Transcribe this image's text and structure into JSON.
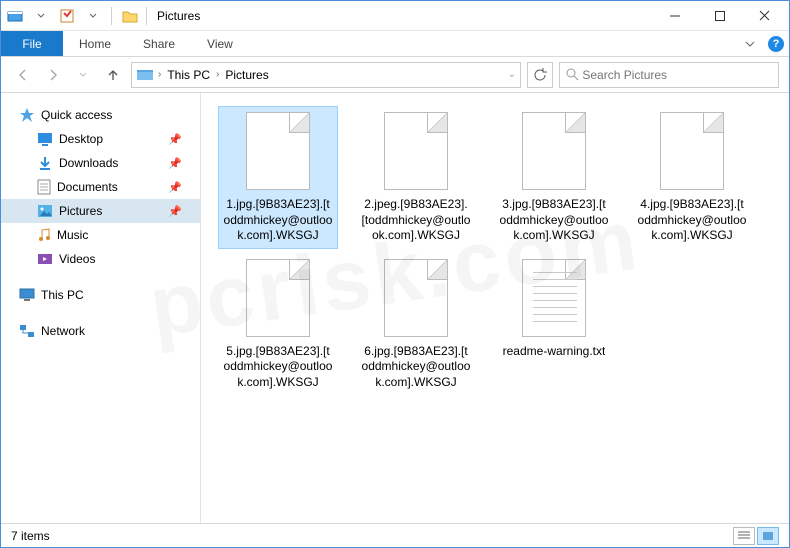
{
  "title": "Pictures",
  "ribbon": {
    "file": "File",
    "tabs": [
      "Home",
      "Share",
      "View"
    ]
  },
  "breadcrumb": {
    "root": "This PC",
    "current": "Pictures"
  },
  "search": {
    "placeholder": "Search Pictures"
  },
  "tree": {
    "quick": "Quick access",
    "items": [
      {
        "label": "Desktop",
        "pinned": true
      },
      {
        "label": "Downloads",
        "pinned": true
      },
      {
        "label": "Documents",
        "pinned": true
      },
      {
        "label": "Pictures",
        "pinned": true,
        "selected": true
      },
      {
        "label": "Music",
        "pinned": false
      },
      {
        "label": "Videos",
        "pinned": false
      }
    ],
    "thispc": "This PC",
    "network": "Network"
  },
  "files": [
    {
      "name": "1.jpg.[9B83AE23].[toddmhickey@outlook.com].WKSGJ",
      "selected": true,
      "type": "blank"
    },
    {
      "name": "2.jpeg.[9B83AE23].[toddmhickey@outlook.com].WKSGJ",
      "type": "blank"
    },
    {
      "name": "3.jpg.[9B83AE23].[toddmhickey@outlook.com].WKSGJ",
      "type": "blank"
    },
    {
      "name": "4.jpg.[9B83AE23].[toddmhickey@outlook.com].WKSGJ",
      "type": "blank"
    },
    {
      "name": "5.jpg.[9B83AE23].[toddmhickey@outlook.com].WKSGJ",
      "type": "blank"
    },
    {
      "name": "6.jpg.[9B83AE23].[toddmhickey@outlook.com].WKSGJ",
      "type": "blank"
    },
    {
      "name": "readme-warning.txt",
      "type": "text"
    }
  ],
  "status": {
    "count": "7 items"
  },
  "watermark": "pcrisk.com"
}
